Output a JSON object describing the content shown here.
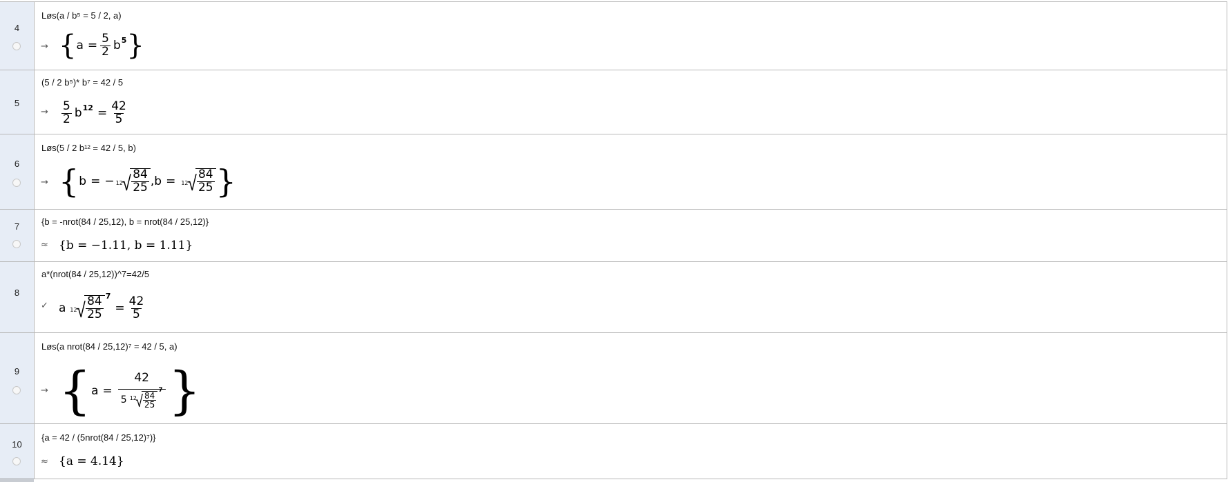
{
  "rows": [
    {
      "number": "4",
      "input": "Løs(a / b⁵ = 5 / 2, a)",
      "marker": "→",
      "output": {
        "lhs": "a",
        "eq": "=",
        "num": "5",
        "den": "2",
        "base": "b",
        "exp": "5"
      }
    },
    {
      "number": "5",
      "input": "(5 / 2 b⁵)* b⁷ = 42 / 5",
      "marker": "→",
      "output": {
        "num1": "5",
        "den1": "2",
        "base": "b",
        "exp": "12",
        "eq": "=",
        "num2": "42",
        "den2": "5"
      }
    },
    {
      "number": "6",
      "input": "Løs(5 / 2 b¹² = 42 / 5, b)",
      "marker": "→",
      "output": {
        "var": "b",
        "eq": "=",
        "minus": "−",
        "idx": "12",
        "num": "84",
        "den": "25",
        "sep": ","
      }
    },
    {
      "number": "7",
      "input": "{b = -nrot(84 / 25,12), b = nrot(84 / 25,12)}",
      "marker": "≈",
      "output": {
        "text": "{b = −1.11, b = 1.11}"
      }
    },
    {
      "number": "8",
      "input": "a*(nrot(84 / 25,12))^7=42/5",
      "marker": "✓",
      "output": {
        "lhs": "a",
        "idx": "12",
        "num": "84",
        "den": "25",
        "exp": "7",
        "eq": "=",
        "num2": "42",
        "den2": "5"
      }
    },
    {
      "number": "9",
      "input": "Løs(a nrot(84 / 25,12)⁷ = 42 / 5, a)",
      "marker": "→",
      "output": {
        "lhs": "a",
        "eq": "=",
        "num": "42",
        "coef": "5",
        "idx": "12",
        "rnum": "84",
        "rden": "25",
        "exp": "7"
      }
    },
    {
      "number": "10",
      "input": "{a = 42 / (5nrot(84 / 25,12)⁷)}",
      "marker": "≈",
      "output": {
        "text": "{a = 4.14}"
      }
    }
  ]
}
